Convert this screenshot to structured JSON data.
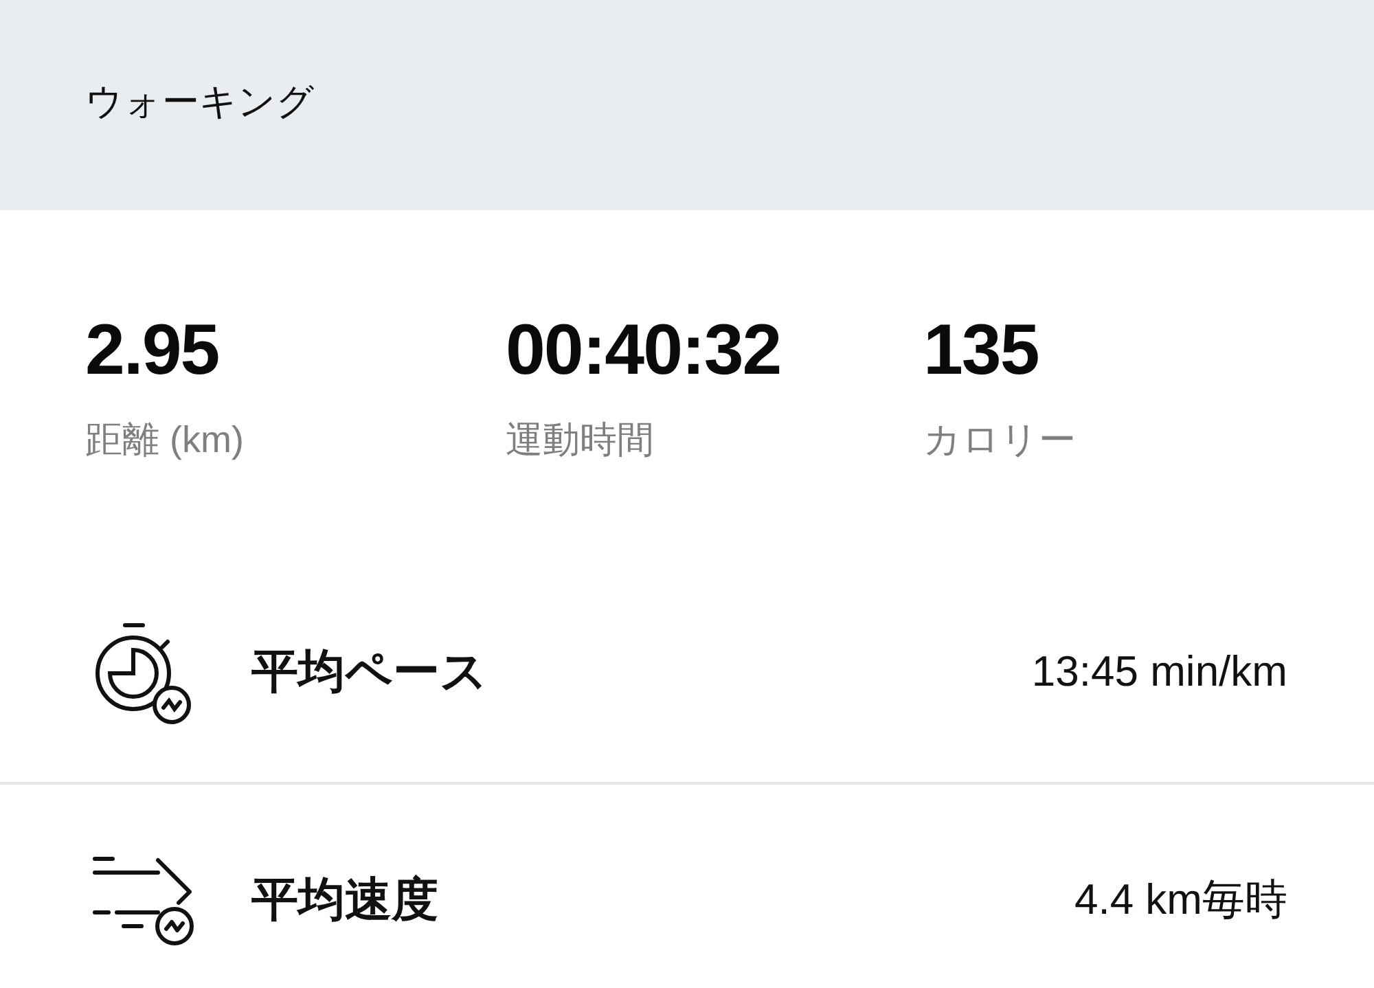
{
  "header": {
    "title": "ウォーキング"
  },
  "stats": [
    {
      "value": "2.95",
      "label": "距離 (km)"
    },
    {
      "value": "00:40:32",
      "label": "運動時間"
    },
    {
      "value": "135",
      "label": "カロリー"
    }
  ],
  "metrics": [
    {
      "kind": "pace",
      "label": "平均ペース",
      "value": "13:45 min/km"
    },
    {
      "kind": "speed",
      "label": "平均速度",
      "value": "4.4 km毎時"
    }
  ]
}
